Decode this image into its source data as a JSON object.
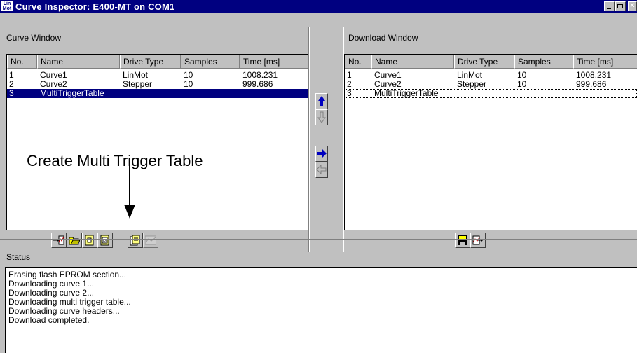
{
  "window": {
    "title": "Curve Inspector: E400-MT on COM1",
    "app_icon_text_1": "Lin",
    "app_icon_text_2": "Mot",
    "close_glyph": "×"
  },
  "curve_window": {
    "label": "Curve Window",
    "columns": [
      "No.",
      "Name",
      "Drive Type",
      "Samples",
      "Time [ms]"
    ],
    "rows": [
      {
        "no": "1",
        "name": "Curve1",
        "drive_type": "LinMot",
        "samples": "10",
        "time": "1008.231"
      },
      {
        "no": "2",
        "name": "Curve2",
        "drive_type": "Stepper",
        "samples": "10",
        "time": "999.686"
      },
      {
        "no": "3",
        "name": "MultiTriggerTable",
        "drive_type": "",
        "samples": "",
        "time": ""
      }
    ],
    "selected_row": 3
  },
  "download_window": {
    "label": "Download Window",
    "columns": [
      "No.",
      "Name",
      "Drive Type",
      "Samples",
      "Time [ms]"
    ],
    "rows": [
      {
        "no": "1",
        "name": "Curve1",
        "drive_type": "LinMot",
        "samples": "10",
        "time": "1008.231"
      },
      {
        "no": "2",
        "name": "Curve2",
        "drive_type": "Stepper",
        "samples": "10",
        "time": "999.686"
      },
      {
        "no": "3",
        "name": "MultiTriggerTable",
        "drive_type": "",
        "samples": "",
        "time": ""
      }
    ]
  },
  "annotation": {
    "text": "Create Multi Trigger Table"
  },
  "status": {
    "label": "Status",
    "lines": [
      "Erasing flash EPROM section...",
      "Downloading curve 1...",
      "Downloading curve 2...",
      "Downloading multi trigger table...",
      "Downloading curve headers...",
      "Download completed."
    ]
  },
  "icons": {
    "curve_toolbar": [
      "import-curve-icon",
      "open-folder-icon",
      "new-curve-icon",
      "new-multi-trigger-table-icon",
      "curve-properties-icon",
      "curve-graph-icon"
    ],
    "download_toolbar": [
      "save-icon",
      "download-to-drive-icon"
    ],
    "transfer": [
      "move-up-icon",
      "move-down-icon",
      "transfer-right-icon",
      "transfer-left-icon"
    ]
  },
  "colors": {
    "titlebar": "#000080",
    "selection": "#000080",
    "face": "#c0c0c0",
    "arrow_blue": "#0000c0"
  }
}
